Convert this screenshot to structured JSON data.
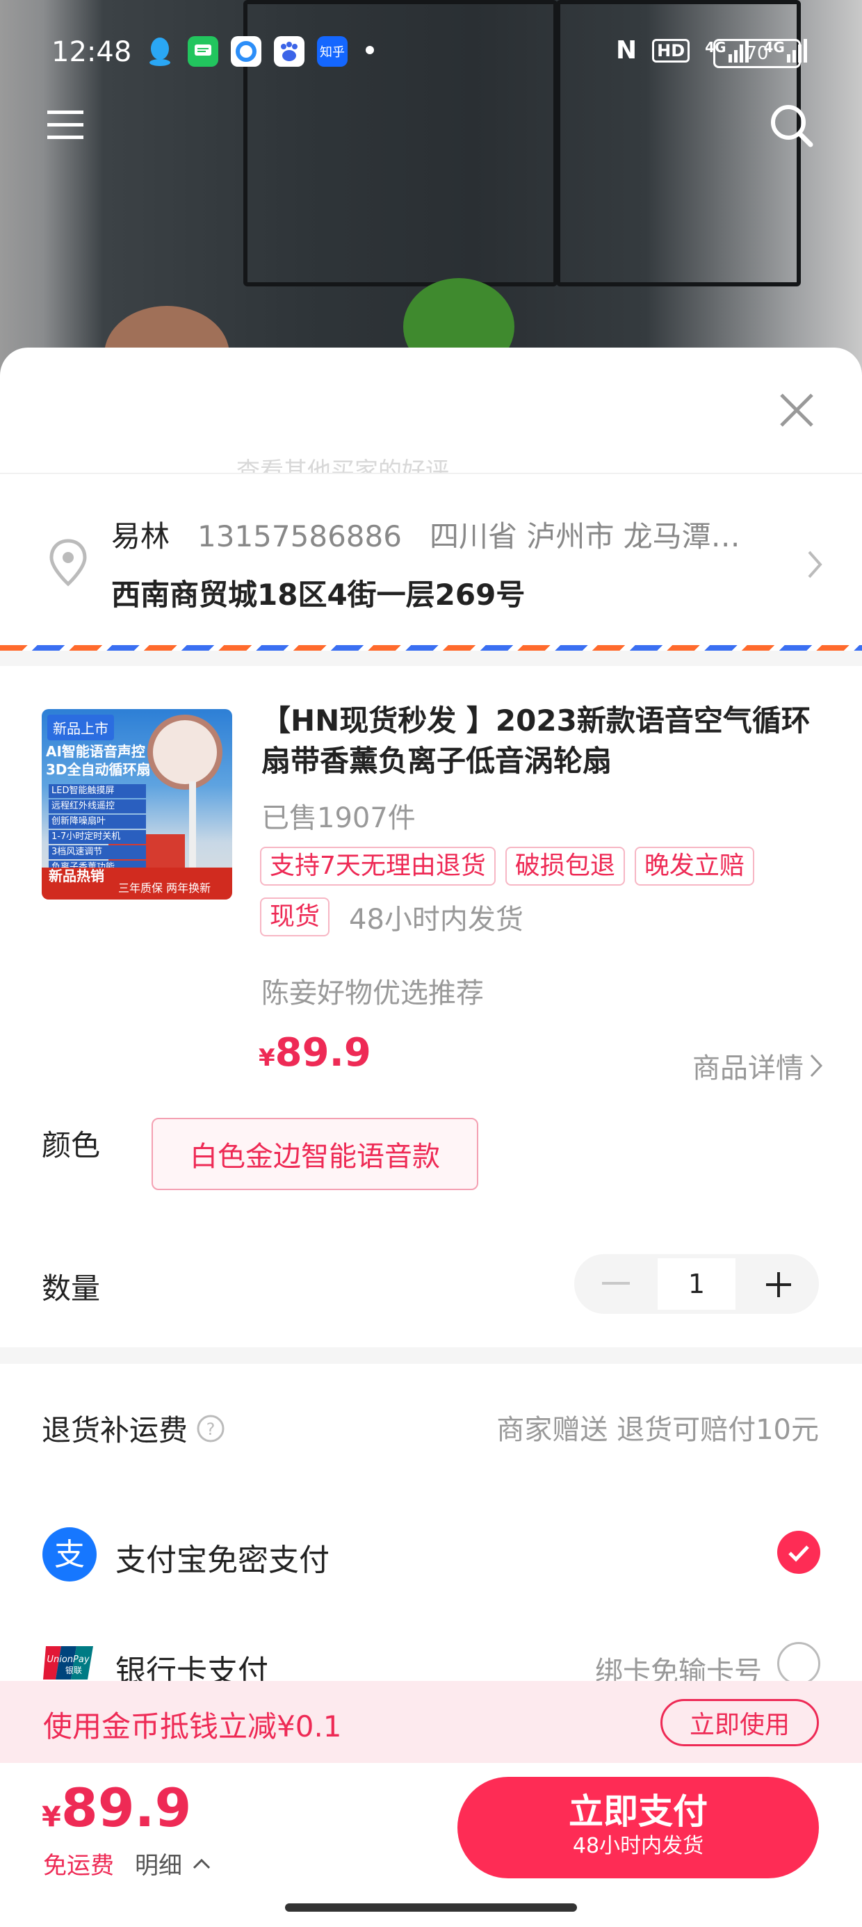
{
  "status_bar": {
    "time": "12:48",
    "apps": [
      {
        "icon": "qq-icon",
        "color": "#1e9bf0",
        "text": ""
      },
      {
        "icon": "message-icon",
        "color": "#22c55e",
        "text": ""
      },
      {
        "icon": "browser-icon",
        "color": "#2c8ef8",
        "text": ""
      },
      {
        "icon": "baidu-icon",
        "color": "#3b64e8",
        "text": ""
      },
      {
        "icon": "zhihu-icon",
        "color": "#1467ff",
        "text": "知乎"
      }
    ],
    "nfc": "N",
    "hd": "HD",
    "sig1": "4G",
    "sig2": "4G",
    "battery": "70"
  },
  "sheet": {
    "ghost_line": "查看其他买家的好评",
    "address": {
      "name": "易林",
      "phone": "13157586886",
      "area": "四川省 泸州市 龙马潭…",
      "detail": "西南商贸城18区4街一层269号"
    },
    "product": {
      "thumb": {
        "badge": "新品上市",
        "headline": "AI智能语音声控 3D全自动循环扇",
        "bullets": [
          "LED智能触摸屏",
          "远程红外线遥控",
          "创新降噪扇叶",
          "1-7小时定时关机",
          "3档风速调节",
          "负离子香薰功能"
        ],
        "hot": "新品热销",
        "guarantee": "三年质保  两年换新"
      },
      "title": "【HN现货秒发 】2023新款语音空气循环扇带香薰负离子低音涡轮扇",
      "sold": "已售1907件",
      "tags": [
        "支持7天无理由退货",
        "破损包退",
        "晚发立赔",
        "现货"
      ],
      "ship_note": "48小时内发货",
      "recommend": "陈妾好物优选推荐",
      "currency": "¥",
      "price": "89.9",
      "detail_link": "商品详情"
    },
    "color_label": "颜色",
    "color_value": "白色金边智能语音款",
    "qty_label": "数量",
    "qty_value": "1",
    "return_label": "退货补运费",
    "return_value": "商家赠送 退货可赔付10元",
    "payments": [
      {
        "label": "支付宝免密支付",
        "hint": "",
        "selected": true
      },
      {
        "label": "银行卡支付",
        "hint": "绑卡免输卡号",
        "selected": false
      }
    ],
    "coin_text": "使用金币抵钱立减¥0.1",
    "coin_button": "立即使用",
    "bottom": {
      "currency": "¥",
      "total": "89.9",
      "free_shipping": "免运费",
      "detail": "明细",
      "pay_main": "立即支付",
      "pay_sub": "48小时内发货"
    }
  },
  "colors": {
    "accent": "#fe2c55",
    "alipay": "#1677ff"
  }
}
